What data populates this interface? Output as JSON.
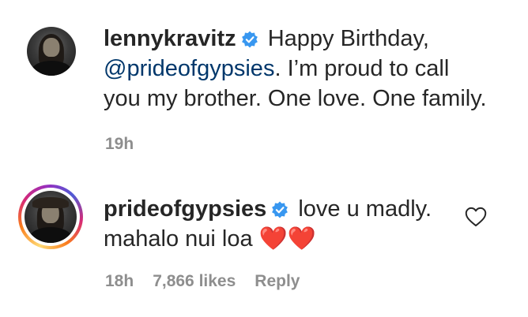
{
  "comments": [
    {
      "username": "lennykravitz",
      "verified": true,
      "line1_text": " Happy Birthday,",
      "mention": "@prideofgypsies",
      "line2_rest": ". I’m proud to call",
      "line3": "you my brother. One love. One family.",
      "time": "19h"
    },
    {
      "username": "prideofgypsies",
      "verified": true,
      "line1_text": " love u madly.",
      "line2": "mahalo nui loa ❤️❤️",
      "time": "18h",
      "likes": "7,866 likes",
      "reply": "Reply"
    }
  ],
  "colors": {
    "text": "#262626",
    "mention": "#00376b",
    "meta": "#8e8e8e",
    "verified": "#3897f0"
  },
  "icons": [
    "verified-badge-icon",
    "heart-outline-icon"
  ]
}
